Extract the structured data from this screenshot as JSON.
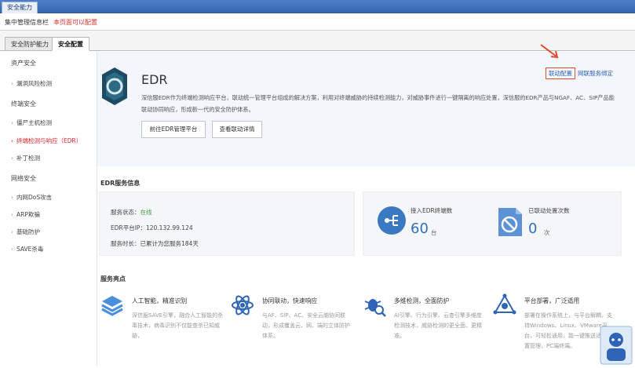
{
  "window": {
    "tab": "安全能力"
  },
  "topbar": {
    "breadcrumb": "集中管理信息栏",
    "warning": "本页面可以配置"
  },
  "tabs": [
    {
      "label": "安全防护能力",
      "active": false
    },
    {
      "label": "安全配置",
      "active": true
    }
  ],
  "sidebar": {
    "groups": [
      {
        "label": "资产安全",
        "items": [
          {
            "label": "漏洞风险检测",
            "active": false
          }
        ]
      },
      {
        "label": "终端安全",
        "items": [
          {
            "label": "僵尸主机检测",
            "active": false
          },
          {
            "label": "终端检测与响应（EDR）",
            "active": true
          },
          {
            "label": "补丁检测",
            "active": false
          }
        ]
      },
      {
        "label": "网络安全",
        "items": [
          {
            "label": "内网DoS攻击",
            "active": false
          },
          {
            "label": "ARP欺骗",
            "active": false
          },
          {
            "label": "基础防护",
            "active": false
          },
          {
            "label": "SAVE杀毒",
            "active": false
          }
        ]
      }
    ]
  },
  "hero": {
    "title": "EDR",
    "description": "深信服EDR作为终端检测响应平台，联动统一管理平台组成的解决方案，利用对终端威胁的持续检测能力，对威胁事件进行一键隔离的响应处置，深信服的EDR产品与NGAF、AC、SIP产品能联动协同响应，形成新一代的安全防护体系。",
    "btn_goto": "前往EDR管理平台",
    "btn_details": "查看联动详情",
    "link_config": "联动配置",
    "link_bind": "网联服务绑定"
  },
  "service_info": {
    "section_title": "EDR服务信息",
    "status_label": "服务状态：",
    "status_value": "在线",
    "ip_label": "EDR平台IP：",
    "ip_value": "120.132.99.124",
    "duration_label": "服务时长：",
    "duration_value": "已累计为您服务184天",
    "stat1_label": "接入EDR终端数",
    "stat1_value": "60",
    "stat1_unit": "台",
    "stat2_label": "已联动处置次数",
    "stat2_value": "0",
    "stat2_unit": "次"
  },
  "highlights": {
    "section_title": "服务亮点",
    "items": [
      {
        "title": "人工智能，精准识别",
        "desc": "深信服SAVE引擎，融合人工智能的杀毒技术，病毒识别不仅能查杀已知威胁，",
        "icon": "layers-icon"
      },
      {
        "title": "协同联动，快速响应",
        "desc": "与AF、SIP、AC、安全云脑协同联动，形成覆盖云、网、端的立体防护体系。",
        "icon": "atom-icon"
      },
      {
        "title": "多维检测，全面防护",
        "desc": "AI引擎、行为引擎、云查引擎多维度检测技术，威胁检测的更全面、更精准。",
        "icon": "bug-search-icon"
      },
      {
        "title": "平台部署，广泛适用",
        "desc": "部署在操作系统上，与平台解耦，支持Windows、Linux、VMware平台，可轻松通用，能一键推送适配配置管理，PC端终端。",
        "icon": "platform-icon"
      }
    ]
  },
  "colors": {
    "accent": "#2f6fbe",
    "alert": "#d9262d",
    "highlight_border": "#e24a2e",
    "online": "#3c9d45"
  }
}
